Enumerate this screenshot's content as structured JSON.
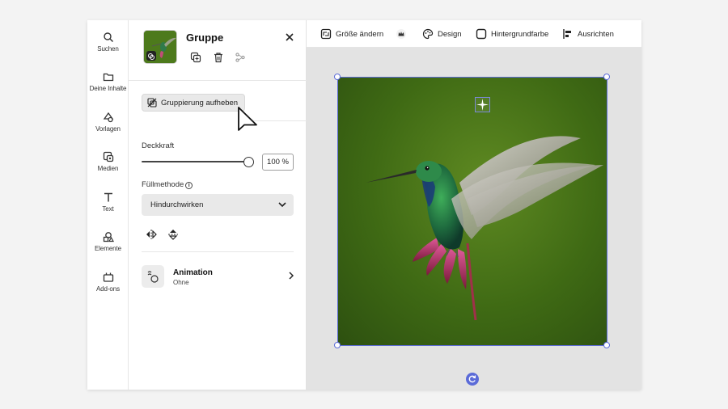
{
  "rail": {
    "items": [
      {
        "label": "Suchen",
        "icon": "search-icon"
      },
      {
        "label": "Deine Inhalte",
        "icon": "folder-icon"
      },
      {
        "label": "Vorlagen",
        "icon": "templates-icon"
      },
      {
        "label": "Medien",
        "icon": "media-icon"
      },
      {
        "label": "Text",
        "icon": "text-icon"
      },
      {
        "label": "Elemente",
        "icon": "elements-icon"
      },
      {
        "label": "Add-ons",
        "icon": "addons-icon"
      }
    ]
  },
  "panel": {
    "title": "Gruppe",
    "ungroup_label": "Gruppierung aufheben",
    "opacity_label": "Deckkraft",
    "opacity_value": "100 %",
    "opacity_level": 1.0,
    "blend_label": "Füllmethode",
    "blend_value": "Hindurchwirken",
    "animation_title": "Animation",
    "animation_value": "Ohne"
  },
  "toolbar": {
    "resize_label": "Größe ändern",
    "design_label": "Design",
    "background_label": "Hintergrundfarbe",
    "align_label": "Ausrichten"
  },
  "colors": {
    "selection": "#5b6bd8",
    "artboard_bg": "#3f6a14"
  }
}
